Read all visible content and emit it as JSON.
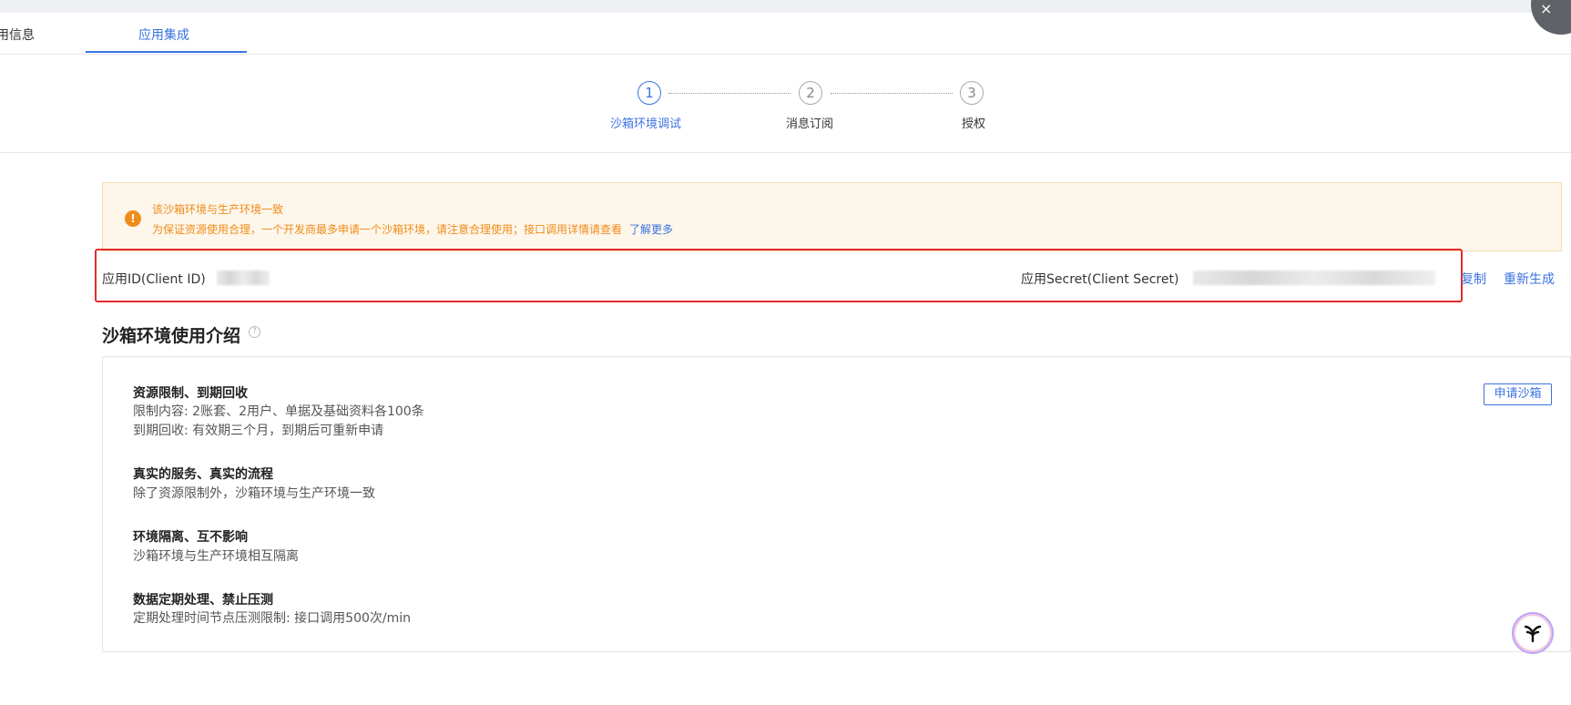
{
  "tabs": [
    {
      "label": "用信息"
    },
    {
      "label": "应用集成"
    }
  ],
  "close_label": "×",
  "steps": [
    {
      "number": "1",
      "label": "沙箱环境调试",
      "active": true
    },
    {
      "number": "2",
      "label": "消息订阅",
      "active": false
    },
    {
      "number": "3",
      "label": "授权",
      "active": false
    }
  ],
  "notice": {
    "icon": "!",
    "line1": "该沙箱环境与生产环境一致",
    "line2": "为保证资源使用合理，一个开发商最多申请一个沙箱环境，请注意合理使用；接口调用详情请查看",
    "link": "了解更多"
  },
  "credentials": {
    "client_id_label": "应用ID(Client ID)",
    "client_secret_label": "应用Secret(Client Secret)",
    "copy_label": "复制",
    "regenerate_label": "重新生成"
  },
  "intro": {
    "title": "沙箱环境使用介绍",
    "help_icon": "?",
    "apply_label": "申请沙箱",
    "items": [
      {
        "title": "资源限制、到期回收",
        "lines": [
          "限制内容: 2账套、2用户、单据及基础资料各100条",
          "到期回收: 有效期三个月，到期后可重新申请"
        ]
      },
      {
        "title": "真实的服务、真实的流程",
        "lines": [
          "除了资源限制外，沙箱环境与生产环境一致"
        ]
      },
      {
        "title": "环境隔离、互不影响",
        "lines": [
          "沙箱环境与生产环境相互隔离"
        ]
      },
      {
        "title": "数据定期处理、禁止压测",
        "lines": [
          "定期处理时间节点压测限制: 接口调用500次/min"
        ]
      }
    ]
  },
  "colors": {
    "accent": "#3b73e0",
    "warning": "#f08c1c",
    "highlight_border": "#e32b2b"
  }
}
